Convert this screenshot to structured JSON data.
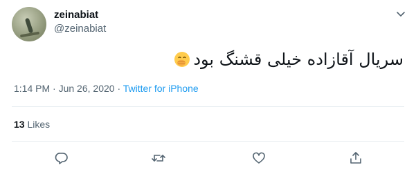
{
  "user": {
    "display_name": "zeinabiat",
    "handle": "@zeinabiat"
  },
  "tweet": {
    "text": "سریال آقازاده خیلی قشنگ بود",
    "emoji": "face-with-hand-over-mouth"
  },
  "meta": {
    "time": "1:14 PM",
    "date": "Jun 26, 2020",
    "separator": "·",
    "source": "Twitter for iPhone"
  },
  "stats": {
    "likes_count": "13",
    "likes_label": "Likes"
  },
  "colors": {
    "link": "#1d9bf0",
    "muted": "#536471",
    "text": "#0f1419",
    "divider": "#e6ecf0"
  },
  "icons": [
    "chevron-down-icon",
    "reply-icon",
    "retweet-icon",
    "like-icon",
    "share-icon"
  ]
}
